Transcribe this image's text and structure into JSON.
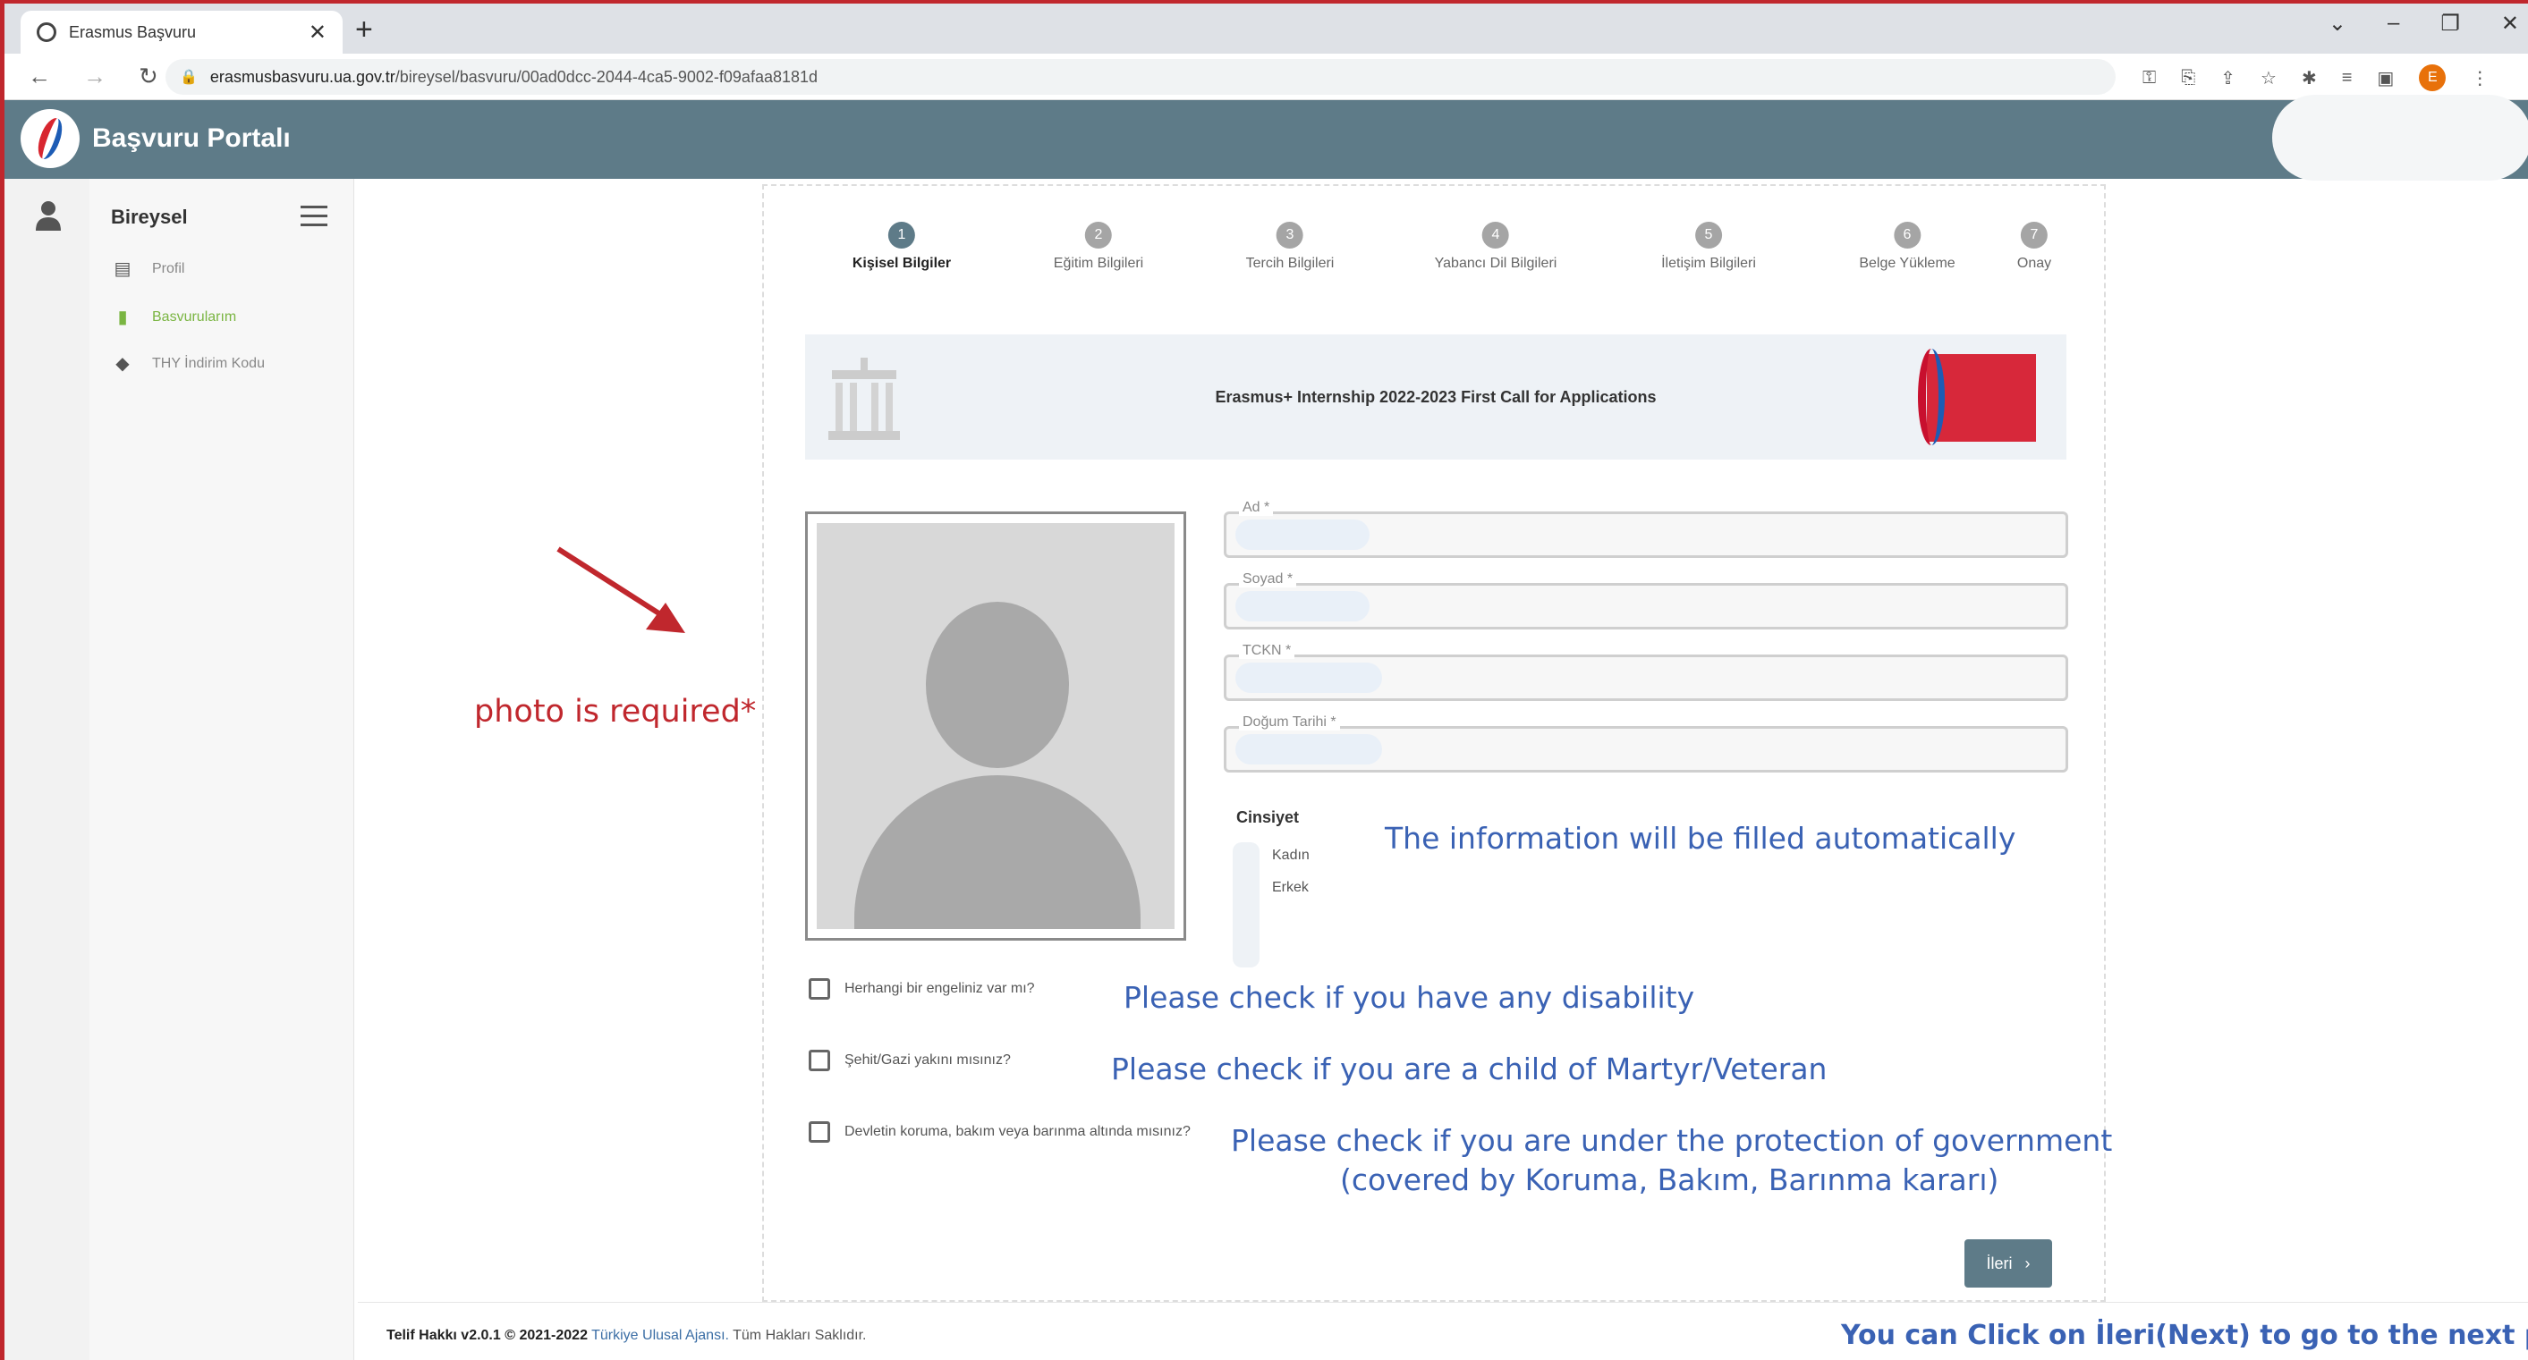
{
  "browser": {
    "tab_title": "Erasmus Başvuru",
    "tab_close": "✕",
    "new_tab": "+",
    "url_host": "erasmusbasvuru.ua.gov.tr",
    "url_path": "/bireysel/basvuru/00ad0dcc-2044-4ca5-9002-f09afaa8181d",
    "profile_initial": "E"
  },
  "app": {
    "title": "Başvuru Portalı"
  },
  "sidebar": {
    "title": "Bireysel",
    "items": [
      {
        "label": "Profil",
        "icon": "id-card-icon"
      },
      {
        "label": "Basvurularım",
        "icon": "clipboard-icon"
      },
      {
        "label": "THY İndirim Kodu",
        "icon": "tag-icon"
      }
    ]
  },
  "steps": [
    {
      "num": "1",
      "label": "Kişisel Bilgiler"
    },
    {
      "num": "2",
      "label": "Eğitim Bilgileri"
    },
    {
      "num": "3",
      "label": "Tercih Bilgileri"
    },
    {
      "num": "4",
      "label": "Yabancı Dil Bilgileri"
    },
    {
      "num": "5",
      "label": "İletişim Bilgileri"
    },
    {
      "num": "6",
      "label": "Belge Yükleme"
    },
    {
      "num": "7",
      "label": "Onay"
    }
  ],
  "banner": {
    "title": "Erasmus+ Internship 2022-2023 First Call for Applications"
  },
  "form": {
    "fields": [
      {
        "label": "Ad *"
      },
      {
        "label": "Soyad *"
      },
      {
        "label": "TCKN *"
      },
      {
        "label": "Doğum Tarihi *"
      }
    ],
    "gender_title": "Cinsiyet",
    "gender_options": [
      "Kadın",
      "Erkek"
    ],
    "checks": [
      "Herhangi bir engeliniz var mı?",
      "Şehit/Gazi yakını mısınız?",
      "Devletin koruma, bakım veya barınma altında mısınız?"
    ],
    "next_label": "İleri",
    "next_chevron": "›"
  },
  "footer": {
    "prefix": "Telif Hakkı v2.0.1 © 2021-2022",
    "org": "Türkiye Ulusal Ajansı.",
    "suffix": "Tüm Hakları Saklıdır."
  },
  "annotations": {
    "photo": "photo is required*",
    "auto_fill": "The information will be filled automatically",
    "disability": "Please check if you have any disability",
    "martyr": "Please check if you are a child of Martyr/Veteran",
    "protection_1": "Please check if you are under the protection of government",
    "protection_2": "(covered by Koruma, Bakım, Barınma kararı)",
    "next_hint": "You can Click on İleri(Next) to go to the next page"
  },
  "colors": {
    "header": "#5e7b88",
    "annotation_red": "#c0272d",
    "annotation_blue": "#3a62b4",
    "active_menu": "#7ab542"
  }
}
